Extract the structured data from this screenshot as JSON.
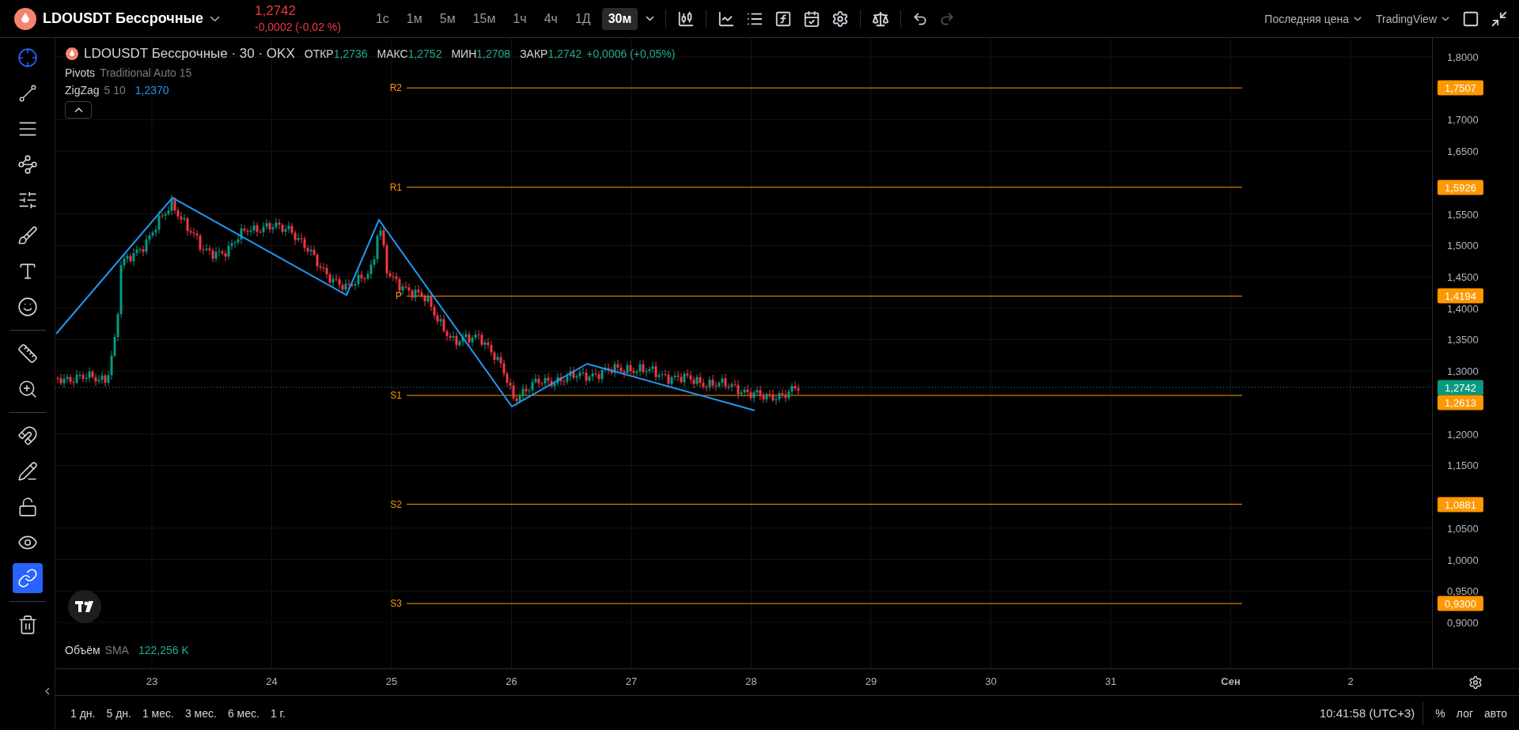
{
  "symbol": {
    "name": "LDOUSDT Бессрочные",
    "price": "1,2742",
    "change": "-0,0002 (-0,02 %)"
  },
  "intervals": [
    {
      "label": "1с",
      "selected": false
    },
    {
      "label": "1м",
      "selected": false
    },
    {
      "label": "5м",
      "selected": false
    },
    {
      "label": "15м",
      "selected": false
    },
    {
      "label": "1ч",
      "selected": false
    },
    {
      "label": "4ч",
      "selected": false
    },
    {
      "label": "1Д",
      "selected": false
    },
    {
      "label": "30м",
      "selected": true
    }
  ],
  "history": [
    {
      "kind": "undo",
      "disabled": false
    },
    {
      "kind": "redo",
      "disabled": true
    }
  ],
  "header_right": {
    "price_source": "Последняя цена",
    "brand": "TradingView"
  },
  "tools": [
    {
      "kind": "crosshair",
      "selected": true
    },
    {
      "kind": "trendline",
      "selected": false
    },
    {
      "kind": "lines",
      "selected": false
    },
    {
      "kind": "pattern",
      "selected": false
    },
    {
      "kind": "fib",
      "selected": false
    },
    {
      "kind": "brush",
      "selected": false
    },
    {
      "kind": "text",
      "selected": false
    },
    {
      "kind": "emoji",
      "selected": false
    },
    {
      "kind": "separator"
    },
    {
      "kind": "ruler",
      "selected": false
    },
    {
      "kind": "zoom",
      "selected": false
    },
    {
      "kind": "separator"
    },
    {
      "kind": "magnet",
      "selected": false
    },
    {
      "kind": "pencil",
      "selected": false
    },
    {
      "kind": "lock",
      "selected": false
    },
    {
      "kind": "eye",
      "selected": false
    },
    {
      "kind": "link",
      "selected": true
    },
    {
      "kind": "separator"
    },
    {
      "kind": "trash",
      "selected": false
    }
  ],
  "legend": {
    "title": "LDOUSDT Бессрочные · 30 · OKX",
    "ohlc": [
      {
        "label": "ОТКР",
        "value": "1,2736"
      },
      {
        "label": "МАКС",
        "value": "1,2752"
      },
      {
        "label": "МИН",
        "value": "1,2708"
      },
      {
        "label": "ЗАКР",
        "value": "1,2742"
      }
    ],
    "change": "+0,0006 (+0,05%)"
  },
  "indicators": [
    {
      "name": "Pivots",
      "params": "Traditional Auto 15"
    },
    {
      "name": "ZigZag",
      "params": "5 10",
      "value": "1,2370"
    }
  ],
  "pivots": [
    {
      "label": "R2",
      "price": "1,7507"
    },
    {
      "label": "R1",
      "price": "1,5926"
    },
    {
      "label": "P",
      "price": "1,4194"
    },
    {
      "label": "S1",
      "price": "1,2613"
    },
    {
      "label": "S2",
      "price": "1,0881"
    },
    {
      "label": "S3",
      "price": "0,9300"
    }
  ],
  "price_axis": {
    "ticks": [
      "1,8000",
      "1,7000",
      "1,6500",
      "1,5500",
      "1,5000",
      "1,4500",
      "1,4000",
      "1,3500",
      "1,3000",
      "1,2000",
      "1,1500",
      "1,0500",
      "1,0000",
      "0,9500",
      "0,9000"
    ],
    "last_price": "1,2742"
  },
  "volume": {
    "name": "Объём",
    "params": "SMA",
    "value": "122,256 K"
  },
  "time_axis": [
    {
      "label": "23",
      "bold": false
    },
    {
      "label": "24",
      "bold": false
    },
    {
      "label": "25",
      "bold": false
    },
    {
      "label": "26",
      "bold": false
    },
    {
      "label": "27",
      "bold": false
    },
    {
      "label": "28",
      "bold": false
    },
    {
      "label": "29",
      "bold": false
    },
    {
      "label": "30",
      "bold": false
    },
    {
      "label": "31",
      "bold": false
    },
    {
      "label": "Сен",
      "bold": true
    },
    {
      "label": "2",
      "bold": false
    }
  ],
  "ranges": [
    "1 дн.",
    "5 дн.",
    "1 мес.",
    "3 мес.",
    "6 мес.",
    "1 г."
  ],
  "status": {
    "time": "10:41:58 (UTC+3)",
    "percent": "%",
    "log": "лог",
    "auto": "авто"
  }
}
